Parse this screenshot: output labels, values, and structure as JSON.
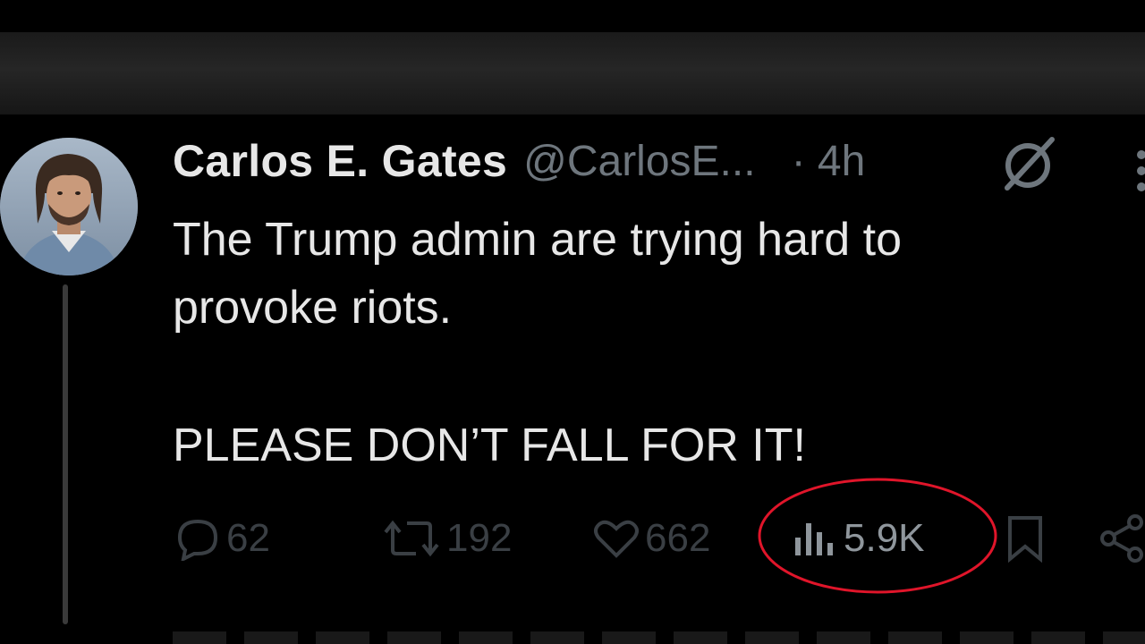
{
  "tweet": {
    "author": {
      "display_name": "Carlos E. Gates",
      "handle": "@CarlosE...",
      "avatar_icon": "user-avatar-photo"
    },
    "timestamp": "· 4h",
    "header_icons": [
      "grok-icon",
      "more-options-icon"
    ],
    "text": {
      "line1": "The Trump admin are trying hard to provoke riots.",
      "line2": "PLEASE DON’T FALL FOR IT!"
    },
    "actions": {
      "replies": "62",
      "reposts": "192",
      "likes": "662",
      "views": "5.9K"
    }
  },
  "annotation": {
    "highlight_color": "#e0152a",
    "highlight_target": "views-count"
  },
  "colors": {
    "background": "#000000",
    "text_primary": "#e7e7e7",
    "text_secondary": "#6e767d"
  }
}
